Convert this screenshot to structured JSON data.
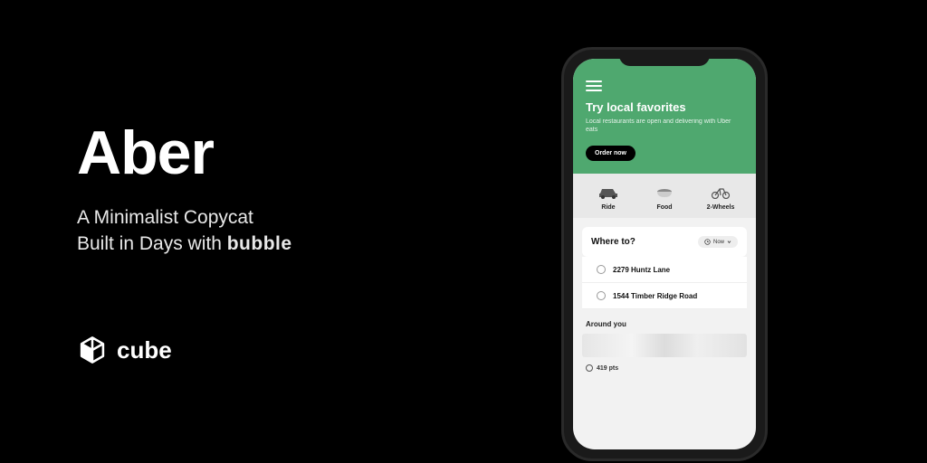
{
  "promo": {
    "title": "Aber",
    "subtitle_line1": "A Minimalist Copycat",
    "subtitle_line2_prefix": "Built in Days with ",
    "subtitle_line2_brand": "bubble",
    "logo_text": "cube"
  },
  "app": {
    "hero": {
      "title": "Try local favorites",
      "subtitle": "Local restaurants are open and delivering with Uber eats",
      "cta": "Order now"
    },
    "categories": [
      {
        "label": "Ride"
      },
      {
        "label": "Food"
      },
      {
        "label": "2-Wheels"
      }
    ],
    "where": {
      "title": "Where to?",
      "time_label": "Now"
    },
    "addresses": [
      {
        "text": "2279  Huntz Lane"
      },
      {
        "text": "1544  Timber Ridge Road"
      }
    ],
    "around_label": "Around you",
    "points": "419 pts"
  }
}
